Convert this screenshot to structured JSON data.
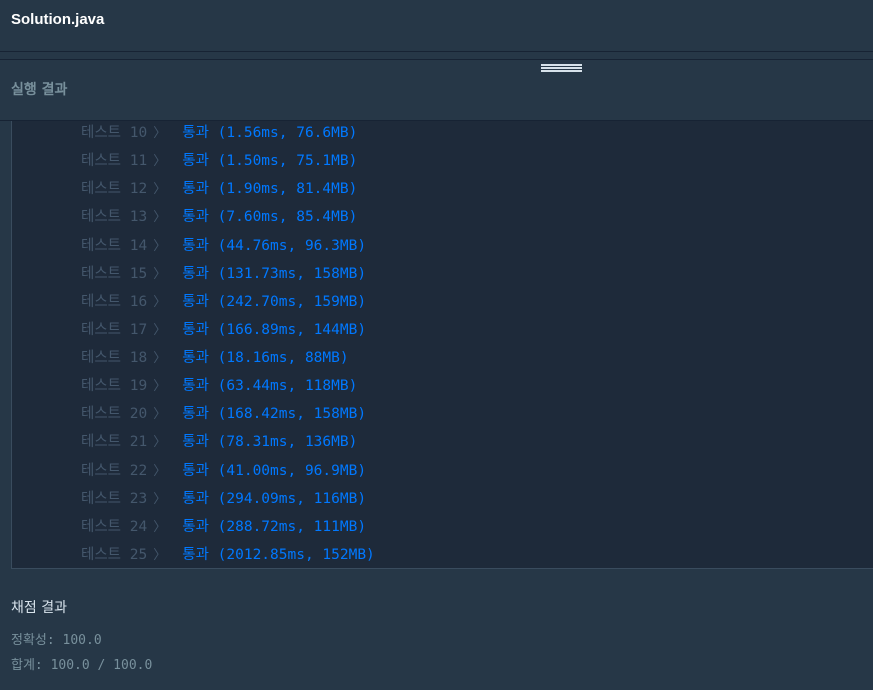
{
  "editor": {
    "file_name": "Solution.java"
  },
  "result_panel": {
    "title": "실행 결과",
    "tests": [
      {
        "label": "테스트 10",
        "status": "통과",
        "detail": "(1.56ms, 76.6MB)"
      },
      {
        "label": "테스트 11",
        "status": "통과",
        "detail": "(1.50ms, 75.1MB)"
      },
      {
        "label": "테스트 12",
        "status": "통과",
        "detail": "(1.90ms, 81.4MB)"
      },
      {
        "label": "테스트 13",
        "status": "통과",
        "detail": "(7.60ms, 85.4MB)"
      },
      {
        "label": "테스트 14",
        "status": "통과",
        "detail": "(44.76ms, 96.3MB)"
      },
      {
        "label": "테스트 15",
        "status": "통과",
        "detail": "(131.73ms, 158MB)"
      },
      {
        "label": "테스트 16",
        "status": "통과",
        "detail": "(242.70ms, 159MB)"
      },
      {
        "label": "테스트 17",
        "status": "통과",
        "detail": "(166.89ms, 144MB)"
      },
      {
        "label": "테스트 18",
        "status": "통과",
        "detail": "(18.16ms, 88MB)"
      },
      {
        "label": "테스트 19",
        "status": "통과",
        "detail": "(63.44ms, 118MB)"
      },
      {
        "label": "테스트 20",
        "status": "통과",
        "detail": "(168.42ms, 158MB)"
      },
      {
        "label": "테스트 21",
        "status": "통과",
        "detail": "(78.31ms, 136MB)"
      },
      {
        "label": "테스트 22",
        "status": "통과",
        "detail": "(41.00ms, 96.9MB)"
      },
      {
        "label": "테스트 23",
        "status": "통과",
        "detail": "(294.09ms, 116MB)"
      },
      {
        "label": "테스트 24",
        "status": "통과",
        "detail": "(288.72ms, 111MB)"
      },
      {
        "label": "테스트 25",
        "status": "통과",
        "detail": "(2012.85ms, 152MB)"
      }
    ],
    "chevron_icon": "chevron-right-icon"
  },
  "grading": {
    "title": "채점 결과",
    "accuracy": "정확성: 100.0",
    "total": "합계: 100.0 / 100.0"
  },
  "colors": {
    "background": "#263747",
    "output_background": "#1e2a3a",
    "pass_blue": "#0078ff",
    "muted_label": "#44576c"
  }
}
